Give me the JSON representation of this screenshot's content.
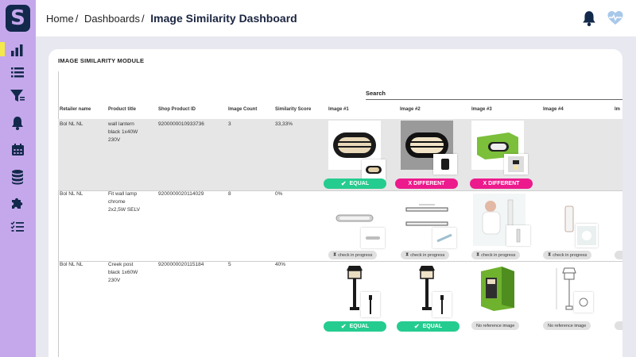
{
  "app": {
    "logo_letter": "S"
  },
  "header": {
    "breadcrumb": [
      "Home",
      "Dashboards"
    ],
    "separator": "/",
    "title": "Image Similarity Dashboard"
  },
  "sidebar": {
    "items": [
      {
        "icon": "bar-chart-icon",
        "active": true
      },
      {
        "icon": "list-icon"
      },
      {
        "icon": "filter-icon"
      },
      {
        "icon": "bell-icon"
      },
      {
        "icon": "calendar-icon"
      },
      {
        "icon": "database-icon"
      },
      {
        "icon": "puzzle-icon"
      },
      {
        "icon": "checklist-icon"
      }
    ]
  },
  "module": {
    "title": "IMAGE SIMILARITY MODULE",
    "search_label": "Search"
  },
  "table": {
    "columns": [
      "Retailer name",
      "Product title",
      "Shop Product ID",
      "Image Count",
      "Similarity Score",
      "Image #1",
      "Image #2",
      "Image #3",
      "Image #4",
      "Im"
    ],
    "rows": [
      {
        "retailer": "Bol NL NL",
        "title_lines": [
          "wall lantern",
          "black 1x40W",
          "230V"
        ],
        "shop_id": "9200000010933736",
        "image_count": "3",
        "score": "33,33%",
        "statuses": [
          {
            "type": "equal",
            "label": "EQUAL"
          },
          {
            "type": "different",
            "label": "X   DIFFERENT"
          },
          {
            "type": "different",
            "label": "X   DIFFERENT"
          }
        ]
      },
      {
        "retailer": "Bol NL NL",
        "title_lines": [
          "Fit wall lamp",
          "chrome",
          "2x2,5W SELV"
        ],
        "shop_id": "9200000020114029",
        "image_count": "8",
        "score": "0%",
        "statuses": [
          {
            "type": "progress",
            "label": "check in progress"
          },
          {
            "type": "progress",
            "label": "check in progress"
          },
          {
            "type": "progress",
            "label": "check in progress"
          },
          {
            "type": "progress",
            "label": "check in progress"
          }
        ]
      },
      {
        "retailer": "Bol NL NL",
        "title_lines": [
          "Creek post",
          "black 1x60W",
          "230V"
        ],
        "shop_id": "9200000020115184",
        "image_count": "5",
        "score": "40%",
        "statuses": [
          {
            "type": "equal",
            "label": "EQUAL"
          },
          {
            "type": "equal",
            "label": "EQUAL"
          },
          {
            "type": "none",
            "label": "No reference image"
          },
          {
            "type": "none",
            "label": "No reference image"
          }
        ]
      }
    ]
  },
  "colors": {
    "sidebar": "#c5a8ec",
    "navy": "#13294b",
    "equal": "#25cc8f",
    "different": "#ec1a8c",
    "active_marker": "#f4e94a"
  }
}
